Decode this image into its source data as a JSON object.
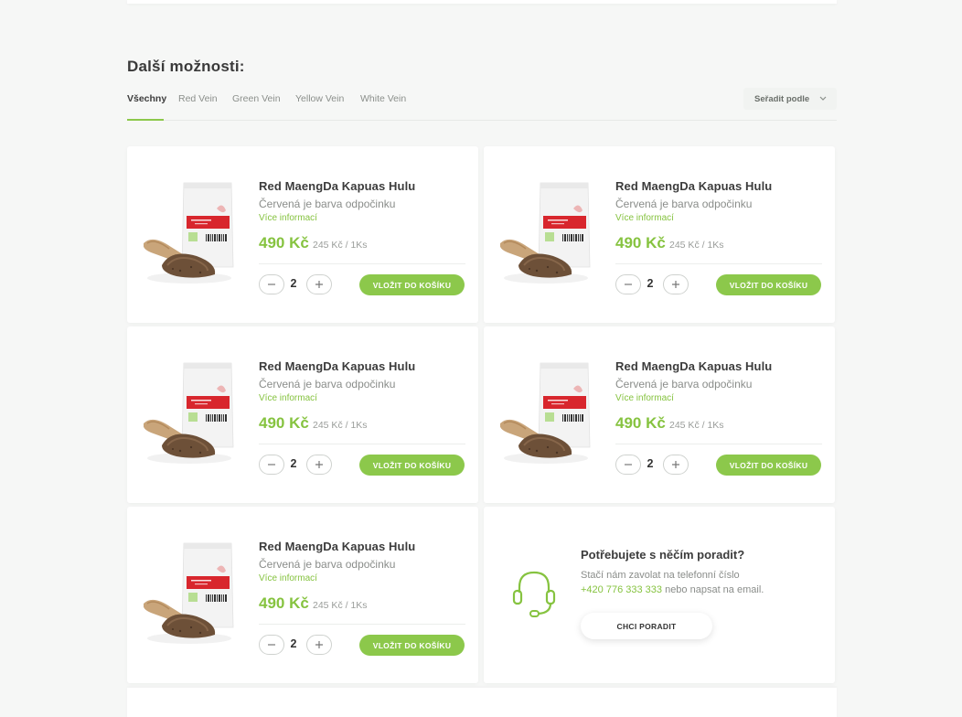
{
  "section": {
    "title": "Další možnosti:"
  },
  "tabs": [
    {
      "label": "Všechny",
      "active": true
    },
    {
      "label": "Red Vein",
      "active": false
    },
    {
      "label": "Green Vein",
      "active": false
    },
    {
      "label": "Yellow Vein",
      "active": false
    },
    {
      "label": "White Vein",
      "active": false
    }
  ],
  "sort": {
    "label": "Seřadit podle"
  },
  "products": [
    {
      "name": "Red MaengDa Kapuas Hulu",
      "description": "Červená je barva odpočinku",
      "more": "Více informací",
      "price": "490 Kč",
      "unit_price": "245 Kč / 1Ks",
      "quantity": "2",
      "add_label": "VLOŽIT DO KOŠÍKU"
    },
    {
      "name": "Red MaengDa Kapuas Hulu",
      "description": "Červená je barva odpočinku",
      "more": "Více informací",
      "price": "490 Kč",
      "unit_price": "245 Kč / 1Ks",
      "quantity": "2",
      "add_label": "VLOŽIT DO KOŠÍKU"
    },
    {
      "name": "Red MaengDa Kapuas Hulu",
      "description": "Červená je barva odpočinku",
      "more": "Více informací",
      "price": "490 Kč",
      "unit_price": "245 Kč / 1Ks",
      "quantity": "2",
      "add_label": "VLOŽIT DO KOŠÍKU"
    },
    {
      "name": "Red MaengDa Kapuas Hulu",
      "description": "Červená je barva odpočinku",
      "more": "Více informací",
      "price": "490 Kč",
      "unit_price": "245 Kč / 1Ks",
      "quantity": "2",
      "add_label": "VLOŽIT DO KOŠÍKU"
    },
    {
      "name": "Red MaengDa Kapuas Hulu",
      "description": "Červená je barva odpočinku",
      "more": "Více informací",
      "price": "490 Kč",
      "unit_price": "245 Kč / 1Ks",
      "quantity": "2",
      "add_label": "VLOŽIT DO KOŠÍKU"
    }
  ],
  "help": {
    "title": "Potřebujete s něčím poradit?",
    "line1": "Stačí nám zavolat na telefonní číslo",
    "phone": "+420 776 333 333",
    "line2_suffix": " nebo napsat na email.",
    "button": "CHCI PORADIT",
    "icon": "headset-icon"
  },
  "colors": {
    "accent": "#8cc84b",
    "accent_text": "#86c340",
    "background": "#f6f7f6"
  }
}
